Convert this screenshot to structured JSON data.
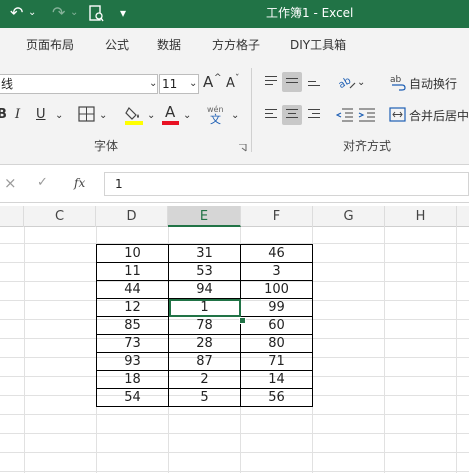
{
  "titlebar": {
    "title": "工作簿1 - Excel",
    "undo_glyph": "↶",
    "redo_glyph": "↷",
    "dropdown_glyph": "⌄",
    "customize_glyph": "▾"
  },
  "tabs": [
    {
      "label": "页面布局"
    },
    {
      "label": "公式"
    },
    {
      "label": "数据"
    },
    {
      "label": "方方格子"
    },
    {
      "label": "DIY工具箱"
    }
  ],
  "ribbon": {
    "font_name": "线",
    "font_size": "11",
    "increase_font": "A",
    "decrease_font": "A",
    "italic": "I",
    "underline": "U",
    "phonetic": "wén",
    "phonetic_char": "文",
    "font_color_letter": "A",
    "wrap_text": "自动换行",
    "merge_center": "合并后居中",
    "font_group": "字体",
    "align_group": "对齐方式"
  },
  "formula_bar": {
    "cancel_icon": "×",
    "enter_icon": "✓",
    "fx": "fx",
    "value": "1"
  },
  "columns": [
    "C",
    "D",
    "E",
    "F",
    "G",
    "H"
  ],
  "selected_column": "E",
  "table": {
    "rows": [
      [
        "10",
        "31",
        "46"
      ],
      [
        "11",
        "53",
        "3"
      ],
      [
        "44",
        "94",
        "100"
      ],
      [
        "12",
        "1",
        "99"
      ],
      [
        "85",
        "78",
        "60"
      ],
      [
        "73",
        "28",
        "80"
      ],
      [
        "93",
        "87",
        "71"
      ],
      [
        "18",
        "2",
        "14"
      ],
      [
        "54",
        "5",
        "56"
      ]
    ],
    "active_cell": {
      "row": 4,
      "column": "E"
    }
  },
  "colors": {
    "title_bar": "#217346",
    "ribbon_bg": "#f3f3f3",
    "fill_color": "#ffff00",
    "font_color": "#e81123",
    "selection": "#217346"
  }
}
